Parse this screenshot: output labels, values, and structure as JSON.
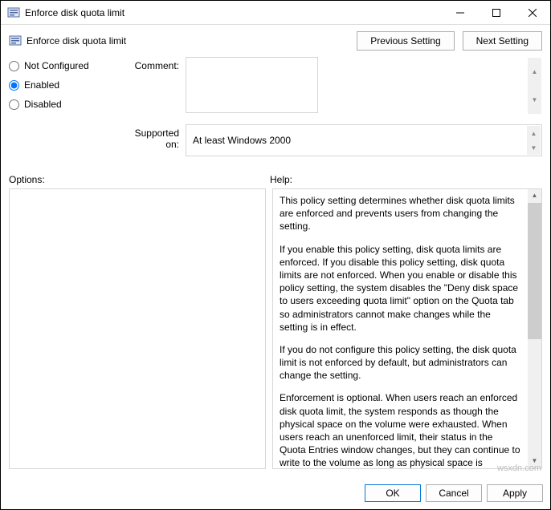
{
  "window": {
    "title": "Enforce disk quota limit"
  },
  "header": {
    "policy_name": "Enforce disk quota limit",
    "prev_btn": "Previous Setting",
    "next_btn": "Next Setting"
  },
  "config": {
    "radio_not_configured": "Not Configured",
    "radio_enabled": "Enabled",
    "radio_disabled": "Disabled",
    "selected": "enabled",
    "comment_label": "Comment:",
    "comment_value": "",
    "supported_label": "Supported on:",
    "supported_value": "At least Windows 2000"
  },
  "panels": {
    "options_label": "Options:",
    "help_label": "Help:"
  },
  "help": {
    "p1": "This policy setting determines whether disk quota limits are enforced and prevents users from changing the setting.",
    "p2": "If you enable this policy setting, disk quota limits are enforced. If you disable this policy setting, disk quota limits are not enforced. When you enable or disable this policy setting, the system disables the \"Deny disk space to users exceeding quota limit\" option on the Quota tab so administrators cannot make changes while the setting is in effect.",
    "p3": "If you do not configure this policy setting, the disk quota limit is not enforced by default, but administrators can change the setting.",
    "p4": "Enforcement is optional. When users reach an enforced disk quota limit, the system responds as though the physical space on the volume were exhausted. When users reach an unenforced limit, their status in the Quota Entries window changes, but they can continue to write to the volume as long as physical space is available."
  },
  "footer": {
    "ok": "OK",
    "cancel": "Cancel",
    "apply": "Apply"
  },
  "watermark": "wsxdn.com"
}
